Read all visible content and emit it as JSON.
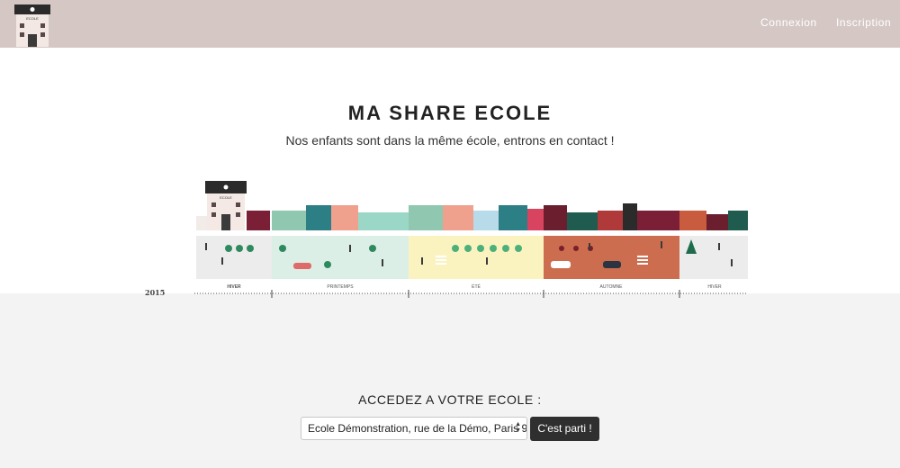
{
  "header": {
    "logo_icon": "school-building-icon",
    "logo_sign": "ECOLE",
    "nav": {
      "login_label": "Connexion",
      "signup_label": "Inscription"
    },
    "background": "#d5c8c4"
  },
  "hero": {
    "title": "MA SHARE ECOLE",
    "subtitle": "Nos enfants sont dans la même école, entrons en contact !",
    "illustration": {
      "school_sign": "ECOLE",
      "year_label": "2015",
      "seasons": [
        {
          "label": "HIVER",
          "color": "#ededed"
        },
        {
          "label": "PRINTEMPS",
          "color": "#dcefe6"
        },
        {
          "label": "ÉTÉ",
          "color": "#fbf3bf"
        },
        {
          "label": "AUTOMNE",
          "color": "#cd6d4f"
        },
        {
          "label": "HIVER",
          "color": "#ededed"
        }
      ]
    }
  },
  "access": {
    "title": "ACCEDEZ A VOTRE ECOLE :",
    "selected_school": "Ecole Démonstration, rue de la Démo, Paris 9",
    "submit_label": "C'est parti !"
  }
}
